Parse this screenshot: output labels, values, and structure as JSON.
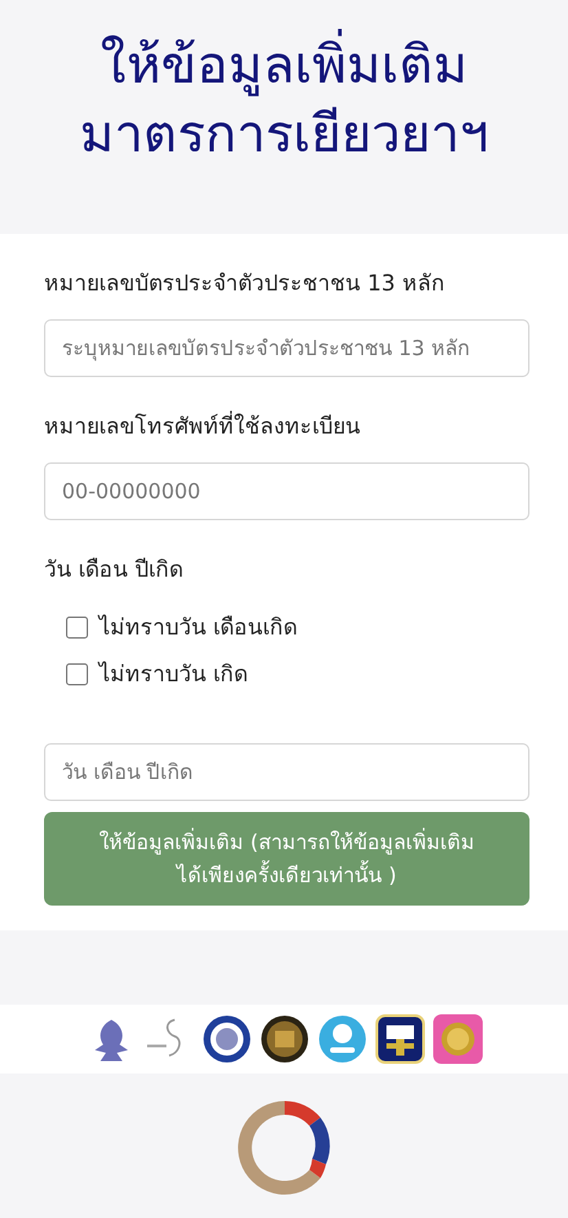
{
  "title_lines": [
    "ให้ข้อมูลเพิ่มเติม",
    "มาตรการเยียวยาฯ"
  ],
  "fields": [
    {
      "label": "หมายเลขบัตรประจำตัวประชาชน 13 หลัก",
      "placeholder": "ระบุหมายเลขบัตรประจำตัวประชาชน 13 หลัก"
    },
    {
      "label": "หมายเลขโทรศัพท์ที่ใช้ลงทะเบียน",
      "placeholder": "00-00000000"
    }
  ],
  "birth_date": {
    "label": "วัน เดือน ปีเกิด",
    "options": [
      {
        "label": "ไม่ทราบวัน เดือนเกิด",
        "checked": false
      },
      {
        "label": "ไม่ทราบวัน เกิด",
        "checked": false
      }
    ],
    "placeholder": "วัน เดือน ปีเกิด"
  },
  "submit_button": "ให้ข้อมูลเพิ่มเติม (สามารถให้ข้อมูลเพิ่มเติมได้เพียงครั้งเดียวเท่านั้น )"
}
